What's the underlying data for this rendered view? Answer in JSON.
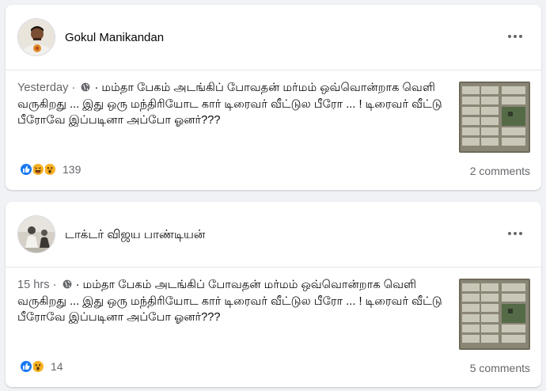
{
  "colors": {
    "page_background": "#f0f2f5",
    "card_background": "#ffffff",
    "secondary_text": "#65676b",
    "like_blue": "#1877f2",
    "haha_yellow": "#f7b125"
  },
  "posts": [
    {
      "author": "Gokul Manikandan",
      "timestamp": "Yesterday",
      "separator": "·",
      "audience_icon": "globe-icon",
      "text": "· மம்தா பேகம் அடங்கிப் போவதன் மர்மம் ஒவ்வொன்றாக வெளி வருகிறது ... இது ஒரு மந்திரியோட கார் டிரைவர் வீட்டுல பீரோ ... ! டிரைவர் வீட்டு பீரோவே இப்படினா அப்போ ஓனர்???",
      "reactions": [
        "like-icon",
        "haha-icon",
        "wow-icon"
      ],
      "reaction_count": "139",
      "comments": "2 comments"
    },
    {
      "author": "டாக்டர் விஜய பாண்டியன்",
      "timestamp": "15 hrs",
      "separator": "·",
      "audience_icon": "globe-icon",
      "text": "· மம்தா பேகம் அடங்கிப் போவதன் மர்மம் ஒவ்வொன்றாக வெளி வருகிறது ... இது ஒரு மந்திரியோட கார் டிரைவர் வீட்டுல பீரோ ... ! டிரைவர் வீட்டு பீரோவே இப்படினா அப்போ ஓனர்???",
      "reactions": [
        "like-icon",
        "wow-icon"
      ],
      "reaction_count": "14",
      "comments": "5 comments"
    }
  ]
}
